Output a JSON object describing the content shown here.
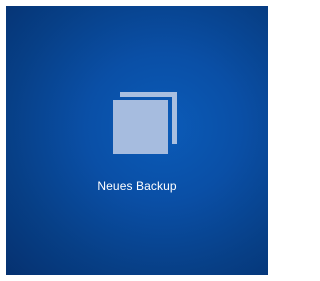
{
  "tile": {
    "label": "Neues Backup",
    "icon": "copy-icon",
    "background_color": "#0a4fa6",
    "icon_color": "#a6bcdf",
    "text_color": "#ffffff"
  }
}
